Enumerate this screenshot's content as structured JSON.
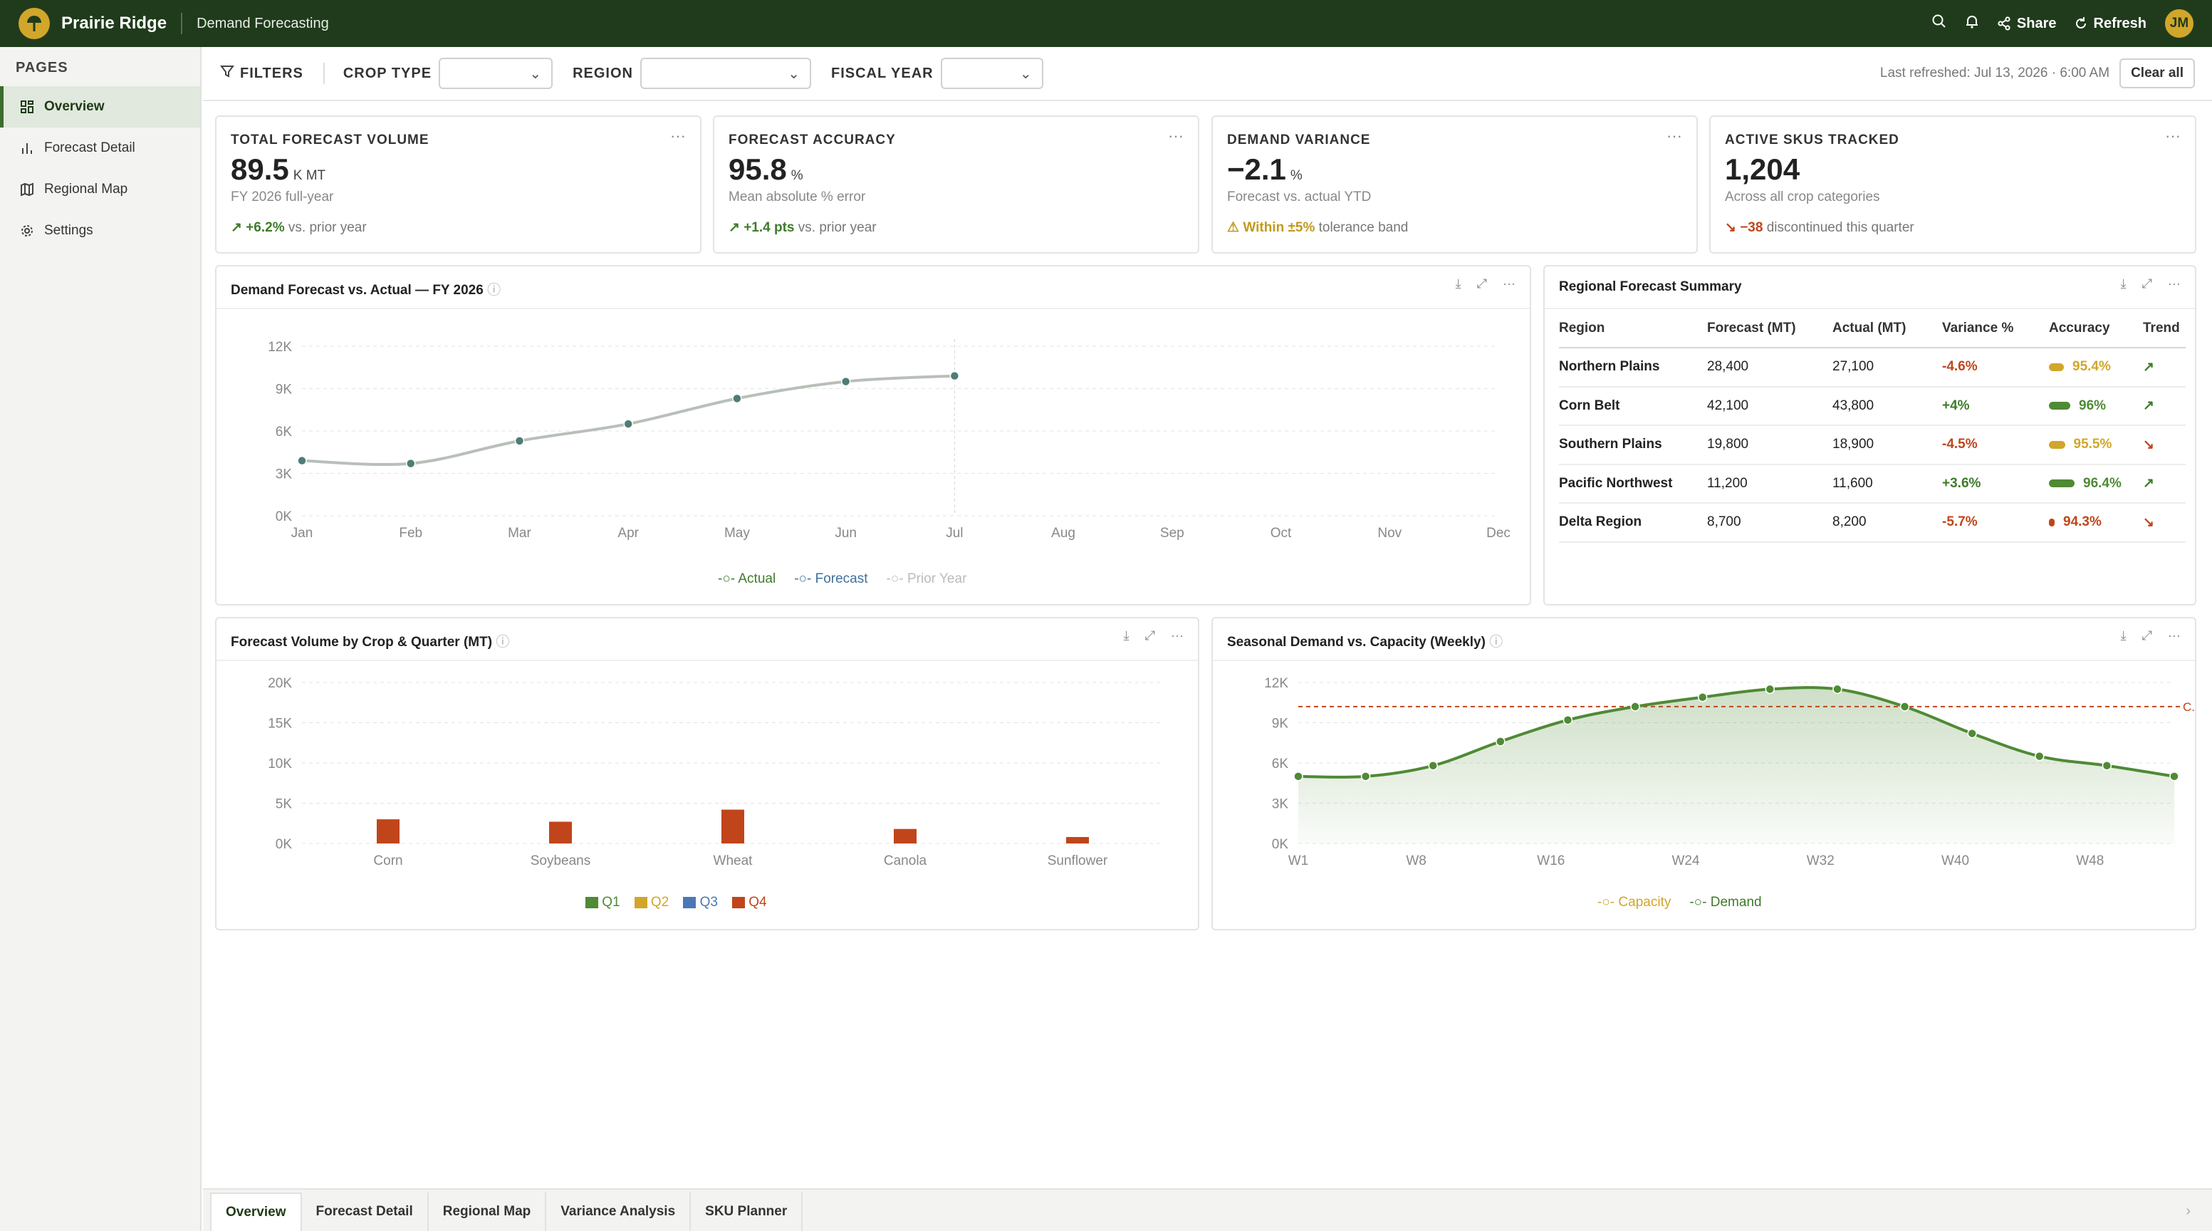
{
  "app": {
    "name": "Prairie Ridge",
    "section": "Demand Forecasting",
    "avatar": "JM"
  },
  "topbar": {
    "share": "Share",
    "refresh": "Refresh"
  },
  "sidebar": {
    "title": "PAGES",
    "items": [
      {
        "label": "Overview",
        "icon": "grid-icon",
        "active": true
      },
      {
        "label": "Forecast Detail",
        "icon": "bar-chart-icon"
      },
      {
        "label": "Regional Map",
        "icon": "map-icon"
      },
      {
        "label": "Settings",
        "icon": "gear-icon"
      }
    ]
  },
  "filters": {
    "label": "FILTERS",
    "crop_type": "CROP TYPE",
    "region": "REGION",
    "fiscal_year": "FISCAL YEAR",
    "last_refreshed": "Last refreshed: Jul 13, 2026 · 6:00 AM",
    "clear_all": "Clear all"
  },
  "kpis": [
    {
      "title": "TOTAL FORECAST VOLUME",
      "value": "89.5",
      "unit": "K MT",
      "sub": "FY 2026 full-year",
      "trend_value": "+6.2%",
      "trend_text": "vs. prior year",
      "status": "good"
    },
    {
      "title": "FORECAST ACCURACY",
      "value": "95.8",
      "unit": "%",
      "sub": "Mean absolute % error",
      "trend_value": "+1.4 pts",
      "trend_text": "vs. prior year",
      "status": "good"
    },
    {
      "title": "DEMAND VARIANCE",
      "value": "−2.1",
      "unit": "%",
      "sub": "Forecast vs. actual YTD",
      "trend_value": "Within ±5%",
      "trend_text": "tolerance band",
      "status": "warn"
    },
    {
      "title": "ACTIVE SKUS TRACKED",
      "value": "1,204",
      "unit": "",
      "sub": "Across all crop categories",
      "trend_value": "−38",
      "trend_text": "discontinued this quarter",
      "status": "bad"
    }
  ],
  "line_panel": {
    "title": "Demand Forecast vs. Actual — FY 2026",
    "legend": [
      "Actual",
      "Forecast",
      "Prior Year"
    ]
  },
  "region_panel": {
    "title": "Regional Forecast Summary",
    "columns": [
      "Region",
      "Forecast (MT)",
      "Actual (MT)",
      "Variance %",
      "Accuracy",
      "Trend"
    ],
    "rows": [
      {
        "region": "Northern Plains",
        "forecast": "28,400",
        "actual": "27,100",
        "variance": "-4.6%",
        "accuracy": "95.4%",
        "acc_value": 95.4,
        "acc_color": "#d1a62a",
        "trend": "up"
      },
      {
        "region": "Corn Belt",
        "forecast": "42,100",
        "actual": "43,800",
        "variance": "+4%",
        "accuracy": "96%",
        "acc_value": 96,
        "acc_color": "#4f8a35",
        "trend": "up"
      },
      {
        "region": "Southern Plains",
        "forecast": "19,800",
        "actual": "18,900",
        "variance": "-4.5%",
        "accuracy": "95.5%",
        "acc_value": 95.5,
        "acc_color": "#d1a62a",
        "trend": "down"
      },
      {
        "region": "Pacific Northwest",
        "forecast": "11,200",
        "actual": "11,600",
        "variance": "+3.6%",
        "accuracy": "96.4%",
        "acc_value": 96.4,
        "acc_color": "#4f8a35",
        "trend": "up"
      },
      {
        "region": "Delta Region",
        "forecast": "8,700",
        "actual": "8,200",
        "variance": "-5.7%",
        "accuracy": "94.3%",
        "acc_value": 94.3,
        "acc_color": "#c0451b",
        "trend": "down"
      }
    ]
  },
  "bar_panel": {
    "title": "Forecast Volume by Crop & Quarter (MT)"
  },
  "area_panel": {
    "title": "Seasonal Demand vs. Capacity (Weekly)",
    "capacity_label": "C..."
  },
  "bottom_tabs": [
    "Overview",
    "Forecast Detail",
    "Regional Map",
    "Variance Analysis",
    "SKU Planner"
  ],
  "colors": {
    "brand": "#203b1c",
    "accent": "#d1a62a",
    "good": "#3e7b2a",
    "bad": "#c0451b",
    "q1": "#4f8a35",
    "q2": "#d1a62a",
    "q3": "#4a78b8",
    "q4": "#c0451b"
  },
  "chart_data": [
    {
      "type": "line",
      "title": "Demand Forecast vs. Actual — FY 2026",
      "categories": [
        "Jan",
        "Feb",
        "Mar",
        "Apr",
        "May",
        "Jun",
        "Jul",
        "Aug",
        "Sep",
        "Oct",
        "Nov",
        "Dec"
      ],
      "yticks": [
        "0K",
        "3K",
        "6K",
        "9K",
        "12K"
      ],
      "ylim": [
        0,
        12000
      ],
      "series": [
        {
          "name": "Actual",
          "values": [
            3900,
            3700,
            5300,
            6500,
            8300,
            9500,
            9900,
            null,
            null,
            null,
            null,
            null
          ]
        },
        {
          "name": "Forecast",
          "values": []
        },
        {
          "name": "Prior Year",
          "values": []
        }
      ],
      "marker_month": "Jul",
      "legend": "bottom",
      "grid": true
    },
    {
      "type": "bar",
      "title": "Forecast Volume by Crop & Quarter (MT)",
      "categories": [
        "Corn",
        "Soybeans",
        "Wheat",
        "Canola",
        "Sunflower"
      ],
      "yticks": [
        "0K",
        "5K",
        "10K",
        "15K",
        "20K"
      ],
      "ylim": [
        0,
        20000
      ],
      "series": [
        {
          "name": "Q1",
          "values": [
            0,
            0,
            0,
            0,
            0
          ]
        },
        {
          "name": "Q2",
          "values": [
            0,
            0,
            0,
            0,
            0
          ]
        },
        {
          "name": "Q3",
          "values": [
            0,
            0,
            0,
            0,
            0
          ]
        },
        {
          "name": "Q4",
          "values": [
            3000,
            2700,
            4200,
            1800,
            800
          ]
        }
      ],
      "legend": "bottom",
      "grid": true
    },
    {
      "type": "area",
      "title": "Seasonal Demand vs. Capacity (Weekly)",
      "xticks": [
        "W1",
        "W8",
        "W16",
        "W24",
        "W32",
        "W40",
        "W48"
      ],
      "x": [
        "W1",
        "W5",
        "W9",
        "W13",
        "W17",
        "W21",
        "W25",
        "W29",
        "W33",
        "W37",
        "W41",
        "W45",
        "W49",
        "W53"
      ],
      "yticks": [
        "0K",
        "3K",
        "6K",
        "9K",
        "12K"
      ],
      "ylim": [
        0,
        12000
      ],
      "series": [
        {
          "name": "Demand",
          "values": [
            5000,
            5000,
            5800,
            7600,
            9200,
            10200,
            10900,
            11500,
            11500,
            10200,
            8200,
            6500,
            5800,
            5000
          ]
        },
        {
          "name": "Capacity",
          "values": [
            10200
          ]
        }
      ],
      "legend": "bottom",
      "grid": true
    }
  ]
}
